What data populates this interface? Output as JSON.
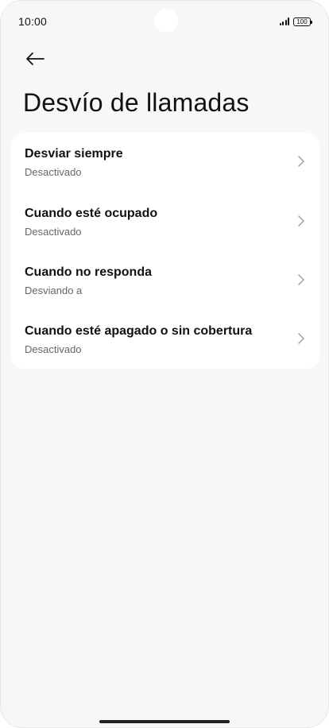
{
  "status_bar": {
    "time": "10:00",
    "battery": "100"
  },
  "header": {
    "back_icon": "arrow-left-icon",
    "title": "Desvío de llamadas"
  },
  "settings": {
    "items": [
      {
        "label": "Desviar siempre",
        "status": "Desactivado",
        "icon": "chevron-right-icon"
      },
      {
        "label": "Cuando esté ocupado",
        "status": "Desactivado",
        "icon": "chevron-right-icon"
      },
      {
        "label": "Cuando no responda",
        "status": "Desviando a",
        "icon": "chevron-right-icon"
      },
      {
        "label": "Cuando esté apagado o sin cobertura",
        "status": "Desactivado",
        "icon": "chevron-right-icon"
      }
    ]
  }
}
